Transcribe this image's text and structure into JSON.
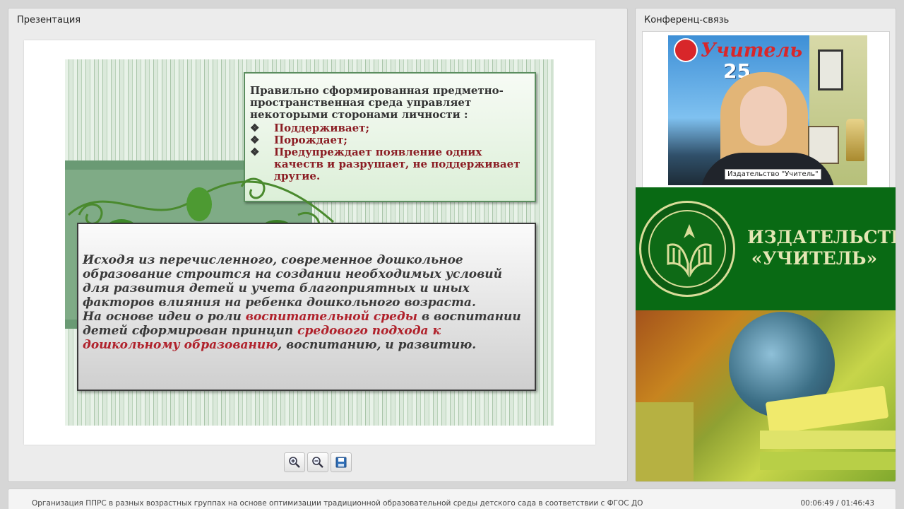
{
  "presentation": {
    "title": "Презентация",
    "slide": {
      "box1": {
        "intro": "Правильно сформированная предметно-пространственная среда управляет некоторыми сторонами личности :",
        "bullet_mark": "❖",
        "bullets": [
          "Поддерживает;",
          "Порождает;",
          "Предупреждает появление одних качеств и разрушает, не поддерживает другие."
        ]
      },
      "box2": {
        "p1": "Исходя из перечисленного,  современное дошкольное образование строится на создании необходимых условий для развития детей и учета благоприятных и иных факторов влияния на  ребенка дошкольного возраста.",
        "p2_a": "На основе идеи о роли ",
        "p2_hl1": "воспитательной среды",
        "p2_b": " в воспитании детей сформирован принцип ",
        "p2_hl2": "средового подхода  к дошкольному образованию",
        "p2_c": ", воспитанию, и развитию."
      }
    },
    "toolbar": {
      "zoom_in_icon": "zoom-in-icon",
      "zoom_out_icon": "zoom-out-icon",
      "save_icon": "floppy-save-icon"
    }
  },
  "conference": {
    "title": "Конференц-связь",
    "video": {
      "backdrop_logo": "Учитель",
      "backdrop_years": "25",
      "caption": "Издательство \"Учитель\""
    },
    "brand": {
      "line1": "ИЗДАТЕЛЬСТВО",
      "line2": "«УЧИТЕЛЬ»"
    }
  },
  "footer": {
    "course_title": "Организация ППРС в разных возрастных группах на основе  оптимизации традиционной образовательной среды детского сада в соответствии с ФГОС ДО",
    "timecode": "00:06:49 / 01:46:43"
  },
  "colors": {
    "accent_red": "#b0222c",
    "brand_green": "#096a14",
    "slide_box_border": "#5b8d5f"
  }
}
